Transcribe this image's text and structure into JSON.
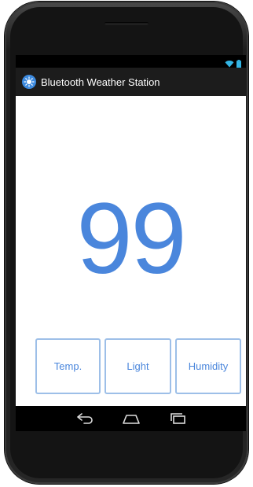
{
  "app": {
    "title": "Bluetooth Weather Station"
  },
  "reading": {
    "value": "99"
  },
  "modes": [
    {
      "label": "Temp."
    },
    {
      "label": "Light"
    },
    {
      "label": "Humidity"
    }
  ],
  "icons": {
    "app": "bluetooth-sun-icon",
    "wifi": "wifi-icon",
    "battery": "battery-icon",
    "back": "back-icon",
    "home": "home-icon",
    "recents": "recent-apps-icon"
  },
  "colors": {
    "accent": "#4a86dc",
    "button_border": "#9dbfe8",
    "action_bar": "#1c1c1c",
    "status_icons": "#33b5e5"
  }
}
